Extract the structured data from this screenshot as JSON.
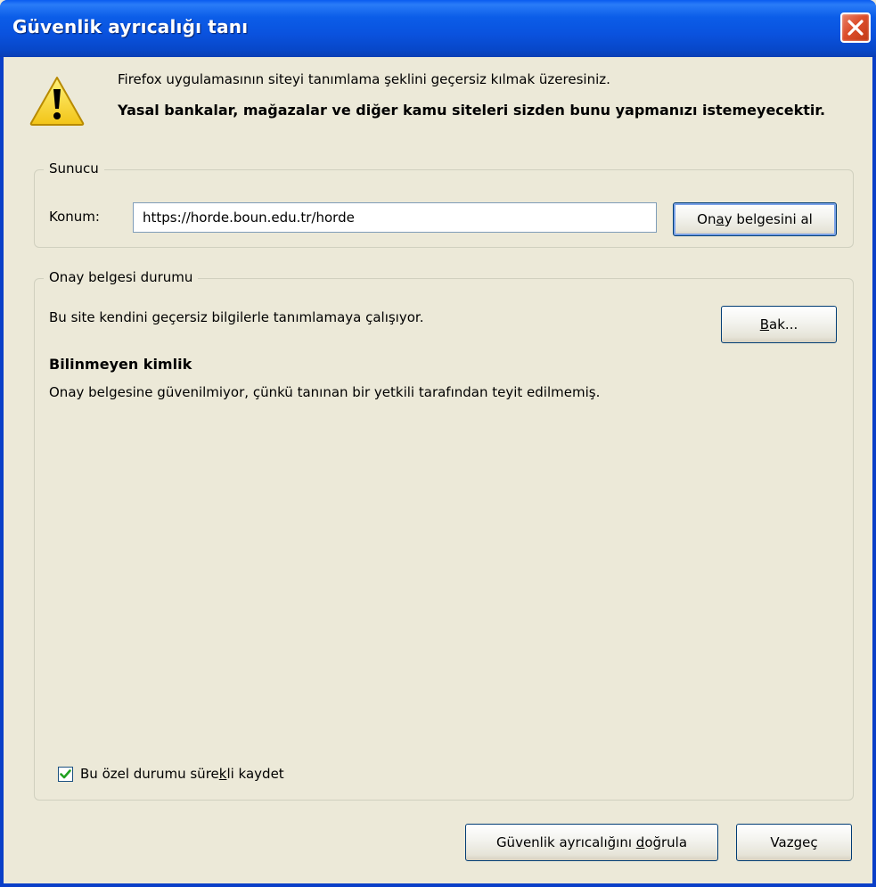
{
  "window": {
    "title": "Güvenlik ayrıcalığı tanı"
  },
  "message": {
    "line1": "Firefox uygulamasının siteyi tanımlama şeklini geçersiz kılmak üzeresiniz.",
    "bold": "Yasal bankalar, mağazalar ve diğer kamu siteleri sizden bunu yapmanızı istemeyecektir."
  },
  "server": {
    "legend": "Sunucu",
    "location_label": "Konum:",
    "location_value": "https://horde.boun.edu.tr/horde",
    "get_cert_pre": "On",
    "get_cert_acc": "a",
    "get_cert_post": "y belgesini al"
  },
  "status": {
    "legend": "Onay belgesi durumu",
    "text": "Bu site kendini geçersiz bilgilerle tanımlamaya çalışıyor.",
    "view_acc": "B",
    "view_post": "ak...",
    "heading": "Bilinmeyen kimlik",
    "description": "Onay belgesine güvenilmiyor, çünkü tanınan bir yetkili tarafından teyit edilmemiş.",
    "permanent_pre": "Bu özel durumu süre",
    "permanent_acc": "k",
    "permanent_post": "li kaydet",
    "permanent_checked": true
  },
  "buttons": {
    "confirm_pre": "Güvenlik ayrıcalığını ",
    "confirm_acc": "d",
    "confirm_post": "oğrula",
    "cancel": "Vazgeç"
  },
  "colors": {
    "titlebar": "#0a52de",
    "close": "#dc4e2c",
    "dialog_bg": "#ece9d8",
    "check": "#21a121"
  },
  "icons": {
    "warning": "warning-triangle-icon",
    "close": "close-x-icon",
    "check": "checkmark-icon"
  }
}
